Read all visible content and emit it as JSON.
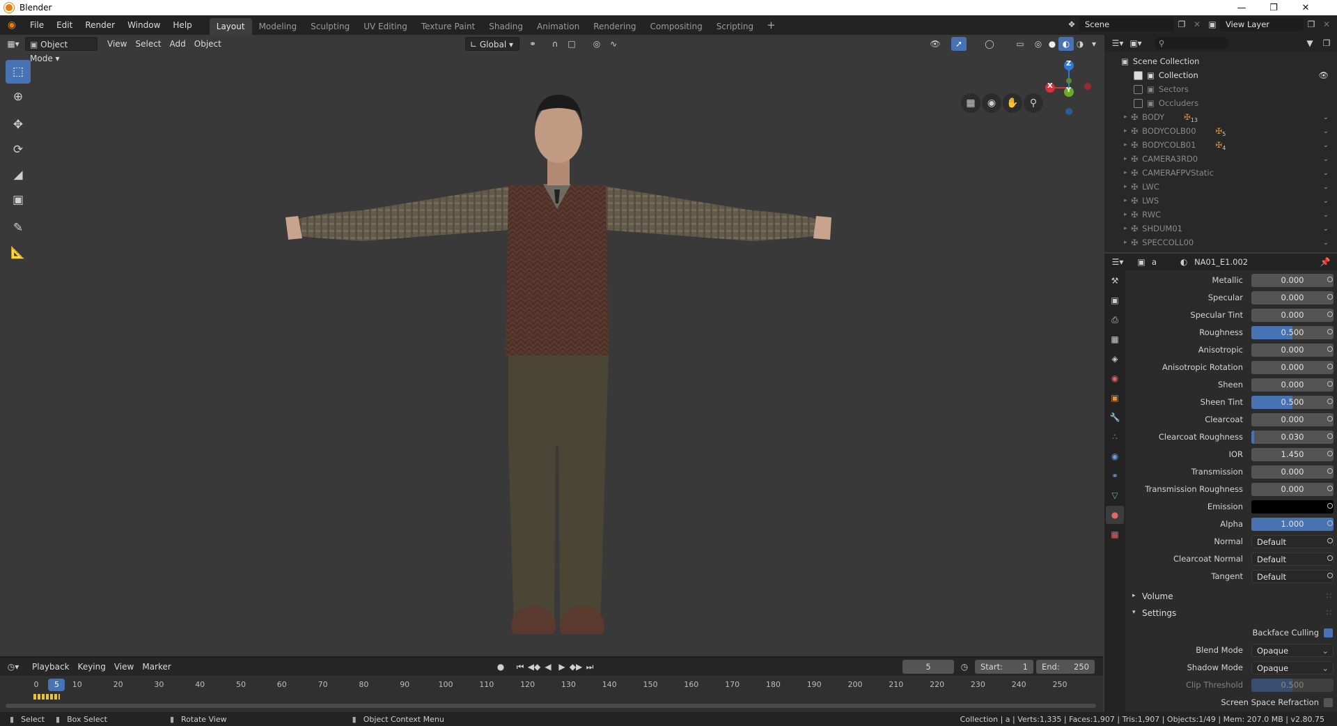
{
  "window": {
    "title": "Blender"
  },
  "menus": [
    "File",
    "Edit",
    "Render",
    "Window",
    "Help"
  ],
  "workspaces": [
    {
      "label": "Layout",
      "active": true
    },
    {
      "label": "Modeling"
    },
    {
      "label": "Sculpting"
    },
    {
      "label": "UV Editing"
    },
    {
      "label": "Texture Paint"
    },
    {
      "label": "Shading"
    },
    {
      "label": "Animation"
    },
    {
      "label": "Rendering"
    },
    {
      "label": "Compositing"
    },
    {
      "label": "Scripting"
    }
  ],
  "scene": {
    "name": "Scene",
    "view_layer": "View Layer"
  },
  "viewport": {
    "mode": "Object Mode",
    "menus": [
      "View",
      "Select",
      "Add",
      "Object"
    ],
    "orientation": "Global",
    "gizmo": {
      "x": "X",
      "y": "Y",
      "z": "Z"
    }
  },
  "outliner": {
    "root": "Scene Collection",
    "collections": [
      {
        "label": "Collection",
        "checked": true
      },
      {
        "label": "Sectors",
        "checked": false
      },
      {
        "label": "Occluders",
        "checked": false
      }
    ],
    "objects": [
      {
        "label": "BODY",
        "count": "13"
      },
      {
        "label": "BODYCOLB00",
        "count": "5"
      },
      {
        "label": "BODYCOLB01",
        "count": "4"
      },
      {
        "label": "CAMERA3RD0"
      },
      {
        "label": "CAMERAFPVStatic"
      },
      {
        "label": "LWC"
      },
      {
        "label": "LWS"
      },
      {
        "label": "RWC"
      },
      {
        "label": "SHDUM01"
      },
      {
        "label": "SPECCOLL00"
      }
    ]
  },
  "properties": {
    "object": "a",
    "material": "NA01_E1.002",
    "fields": [
      {
        "label": "Metallic",
        "value": "0.000",
        "fill": 0
      },
      {
        "label": "Specular",
        "value": "0.000",
        "fill": 0
      },
      {
        "label": "Specular Tint",
        "value": "0.000",
        "fill": 0
      },
      {
        "label": "Roughness",
        "value": "0.500",
        "fill": 0.5
      },
      {
        "label": "Anisotropic",
        "value": "0.000",
        "fill": 0
      },
      {
        "label": "Anisotropic Rotation",
        "value": "0.000",
        "fill": 0
      },
      {
        "label": "Sheen",
        "value": "0.000",
        "fill": 0
      },
      {
        "label": "Sheen Tint",
        "value": "0.500",
        "fill": 0.5
      },
      {
        "label": "Clearcoat",
        "value": "0.000",
        "fill": 0
      },
      {
        "label": "Clearcoat Roughness",
        "value": "0.030",
        "fill": 0.03
      },
      {
        "label": "IOR",
        "value": "1.450",
        "fill": 0
      },
      {
        "label": "Transmission",
        "value": "0.000",
        "fill": 0
      },
      {
        "label": "Transmission Roughness",
        "value": "0.000",
        "fill": 0
      },
      {
        "label": "Emission",
        "value": "",
        "color": "#000000"
      },
      {
        "label": "Alpha",
        "value": "1.000",
        "fill": 1
      },
      {
        "label": "Normal",
        "value": "Default",
        "dd": true
      },
      {
        "label": "Clearcoat Normal",
        "value": "Default",
        "dd": true
      },
      {
        "label": "Tangent",
        "value": "Default",
        "dd": true
      }
    ],
    "panels": {
      "volume": "Volume",
      "settings": "Settings"
    },
    "settings": {
      "backface_culling": "Backface Culling",
      "blend_mode_label": "Blend Mode",
      "blend_mode": "Opaque",
      "shadow_mode_label": "Shadow Mode",
      "shadow_mode": "Opaque",
      "clip_threshold_label": "Clip Threshold",
      "clip_threshold": "0.500",
      "ssr_label": "Screen Space Refraction"
    }
  },
  "timeline": {
    "menus": [
      "Playback",
      "Keying",
      "View",
      "Marker"
    ],
    "current": "5",
    "start_label": "Start:",
    "start": "1",
    "end_label": "End:",
    "end": "250",
    "ticks": [
      "0",
      "10",
      "20",
      "30",
      "40",
      "50",
      "60",
      "70",
      "80",
      "90",
      "100",
      "110",
      "120",
      "130",
      "140",
      "150",
      "160",
      "170",
      "180",
      "190",
      "200",
      "210",
      "220",
      "230",
      "240",
      "250"
    ]
  },
  "status": {
    "select": "Select",
    "box_select": "Box Select",
    "rotate": "Rotate View",
    "context": "Object Context Menu",
    "info": "Collection | a | Verts:1,335 | Faces:1,907 | Tris:1,907 | Objects:1/49 | Mem: 207.0 MB | v2.80.75"
  },
  "colors": {
    "accent": "#4772b3",
    "panel": "#2b2b2b",
    "viewport": "#393939"
  }
}
